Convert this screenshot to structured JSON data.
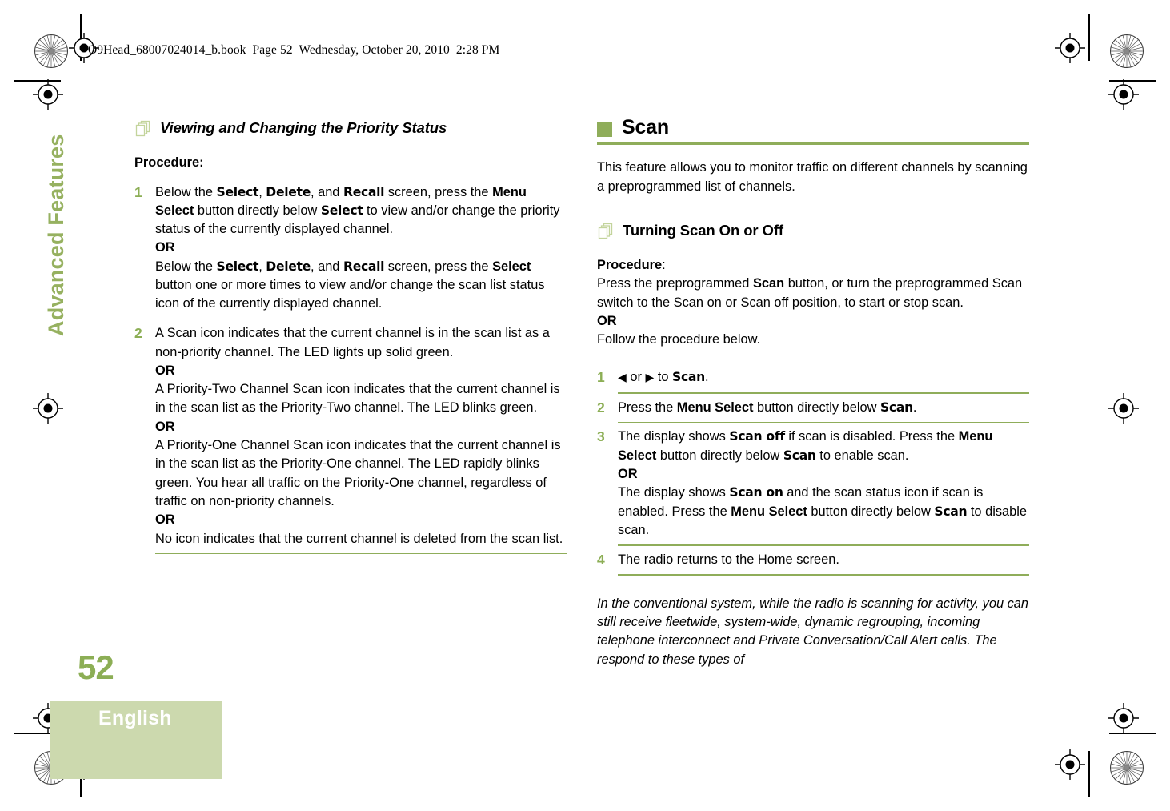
{
  "document": {
    "book_header": "O9Head_68007024014_b.book  Page 52  Wednesday, October 20, 2010  2:28 PM",
    "chapter_tab": "Advanced Features",
    "page_number": "52",
    "language": "English"
  },
  "colors": {
    "accent_green": "#8fad5a",
    "number_green": "#8cae55",
    "tab_green": "#96b160",
    "lang_box_green": "#ccd9ae",
    "icon_outline_green": "#c3d49c"
  },
  "left_column": {
    "heading": "Viewing and Changing the Priority Status",
    "procedure_label": "Procedure:",
    "steps": [
      {
        "number": "1",
        "lines": [
          "Below the ",
          "Select",
          ", ",
          "Delete",
          ", and ",
          "Recall",
          " screen, press the ",
          "Menu Select",
          " button directly below ",
          "Select",
          " to view and/or change the priority status of the currently displayed channel.",
          "OR",
          "Below the ",
          "Select",
          ", ",
          "Delete",
          ", and ",
          "Recall",
          " screen, press the ",
          "Select",
          " button one or more times to view and/or change the scan list status icon of the currently displayed channel."
        ],
        "part_a_pre": "Below the ",
        "part_a_mid1": ", ",
        "part_a_mid2": ", and ",
        "part_a_after_recall": " screen, press the ",
        "part_a_after_menu": " button directly below ",
        "part_a_tail": " to view and/or change the priority status of the currently displayed channel.",
        "or": "OR",
        "part_b_after_recall": " screen, press the ",
        "part_b_tail": " button one or more times to view and/or change the scan list status icon of the currently displayed channel.",
        "ui_select": "Select",
        "ui_delete": "Delete",
        "ui_recall": "Recall",
        "ui_menu_select": "Menu Select"
      },
      {
        "number": "2",
        "para1": "A Scan icon indicates that the current channel is in the scan list as a non-priority channel. The LED lights up solid green.",
        "or1": "OR",
        "para2": "A Priority-Two Channel Scan icon indicates that the current channel is in the scan list as the Priority-Two channel. The LED blinks green.",
        "or2": "OR",
        "para3": "A Priority-One Channel Scan icon indicates that the current channel is in the scan list as the Priority-One channel. The LED rapidly blinks green. You hear all traffic on the Priority-One channel, regardless of traffic on non-priority channels.",
        "or3": "OR",
        "para4": "No icon indicates that the current channel is deleted from the scan list."
      }
    ]
  },
  "right_column": {
    "section_heading": "Scan",
    "intro": "This feature allows you to monitor traffic on different channels by scanning a preprogrammed list of channels.",
    "sub_heading": "Turning Scan On or Off",
    "procedure_label": "Procedure",
    "procedure_colon": ":",
    "procedure_line1_pre": "Press the preprogrammed ",
    "procedure_line1_ui": "Scan",
    "procedure_line1_post": " button, or turn the preprogrammed Scan switch to the Scan on or Scan off position, to start or stop scan.",
    "procedure_or": "OR",
    "procedure_follow": "Follow the procedure below.",
    "steps": [
      {
        "number": "1",
        "arrow_left": "◀",
        "or_word": " or ",
        "arrow_right": "▶",
        "to_word": " to ",
        "ui_scan": "Scan",
        "period": "."
      },
      {
        "number": "2",
        "pre": "Press the ",
        "ui_menu_select": "Menu Select",
        "mid": " button directly below ",
        "ui_scan": "Scan",
        "period": "."
      },
      {
        "number": "3",
        "a_pre": "The display shows ",
        "a_ui_scan_off": "Scan off",
        "a_mid": " if scan is disabled. Press the ",
        "a_ui_menu_select": "Menu Select",
        "a_mid2": " button directly below ",
        "a_ui_scan": "Scan",
        "a_tail": " to enable scan.",
        "or": "OR",
        "b_pre": "The display shows ",
        "b_ui_scan_on": "Scan on",
        "b_mid": " and the scan status icon if scan is enabled. Press the ",
        "b_ui_menu_select": "Menu Select",
        "b_mid2": " button directly below ",
        "b_ui_scan": "Scan",
        "b_tail": " to disable scan."
      },
      {
        "number": "4",
        "text": "The radio returns to the Home screen."
      }
    ],
    "note": "In the conventional system, while the radio is scanning for activity, you can still receive fleetwide, system-wide, dynamic regrouping, incoming telephone interconnect and Private Conversation/Call Alert calls. The respond to these types of"
  }
}
